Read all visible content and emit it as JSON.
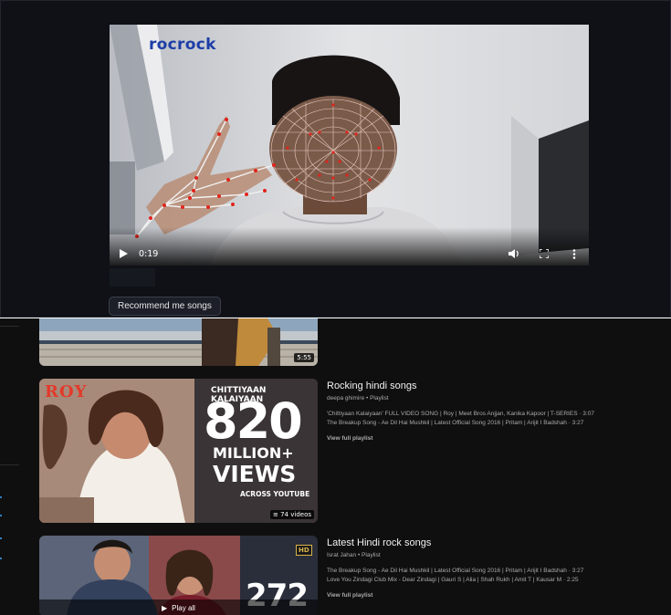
{
  "app": {
    "video": {
      "watermark": "rocrock",
      "current_time": "0:19",
      "stop_label": ""
    },
    "recommend_button": "Recommend me songs"
  },
  "youtube": {
    "top_thumb": {
      "duration": "5:55"
    },
    "results": [
      {
        "title": "Rocking hindi songs",
        "channel": "deepa ghimire",
        "type": "Playlist",
        "meta": "deepa ghimire • Playlist",
        "thumb_text": {
          "movie": "ROY",
          "song": "CHITTIYAAN KALAIYAAN",
          "big_number": "820",
          "unit": "MILLION+",
          "views": "VIEWS",
          "sub": "ACROSS YOUTUBE"
        },
        "badge": "74 videos",
        "songs": [
          "'Chittiyaan Kalaiyaan' FULL VIDEO SONG | Roy | Meet Bros Anjjan, Kanika Kapoor | T-SERIES · 3:07",
          "The Breakup Song - Ae Dil Hai Mushkil | Latest Official Song 2016 | Pritam | Arijit I Badshah · 3:27"
        ],
        "view_full": "View full playlist"
      },
      {
        "title": "Latest Hindi rock songs",
        "channel": "Israt Jahan",
        "type": "Playlist",
        "meta": "Israt Jahan • Playlist",
        "thumb_text": {
          "hd": "HD",
          "big_number": "272",
          "play_all": "Play all"
        },
        "songs": [
          "The Breakup Song - Ae Dil Hai Mushkil | Latest Official Song 2016 | Pritam | Arijit I Badshah · 3:27",
          "Love You Zindagi Club Mix - Dear Zindagi | Gauri S | Alia | Shah Rukh | Amit T | Kausar M · 2:25"
        ],
        "view_full": "View full playlist"
      }
    ]
  },
  "colors": {
    "app_bg": "#0f1117",
    "yt_bg": "#0f0f0f",
    "brand_blue": "#1d3ea8",
    "landmark_red": "#e0241b",
    "yt_link_blue": "#3ea6ff"
  },
  "icons": [
    "play-icon",
    "volume-icon",
    "fullscreen-icon",
    "more-vert-icon",
    "queue-icon",
    "play-all-icon"
  ]
}
